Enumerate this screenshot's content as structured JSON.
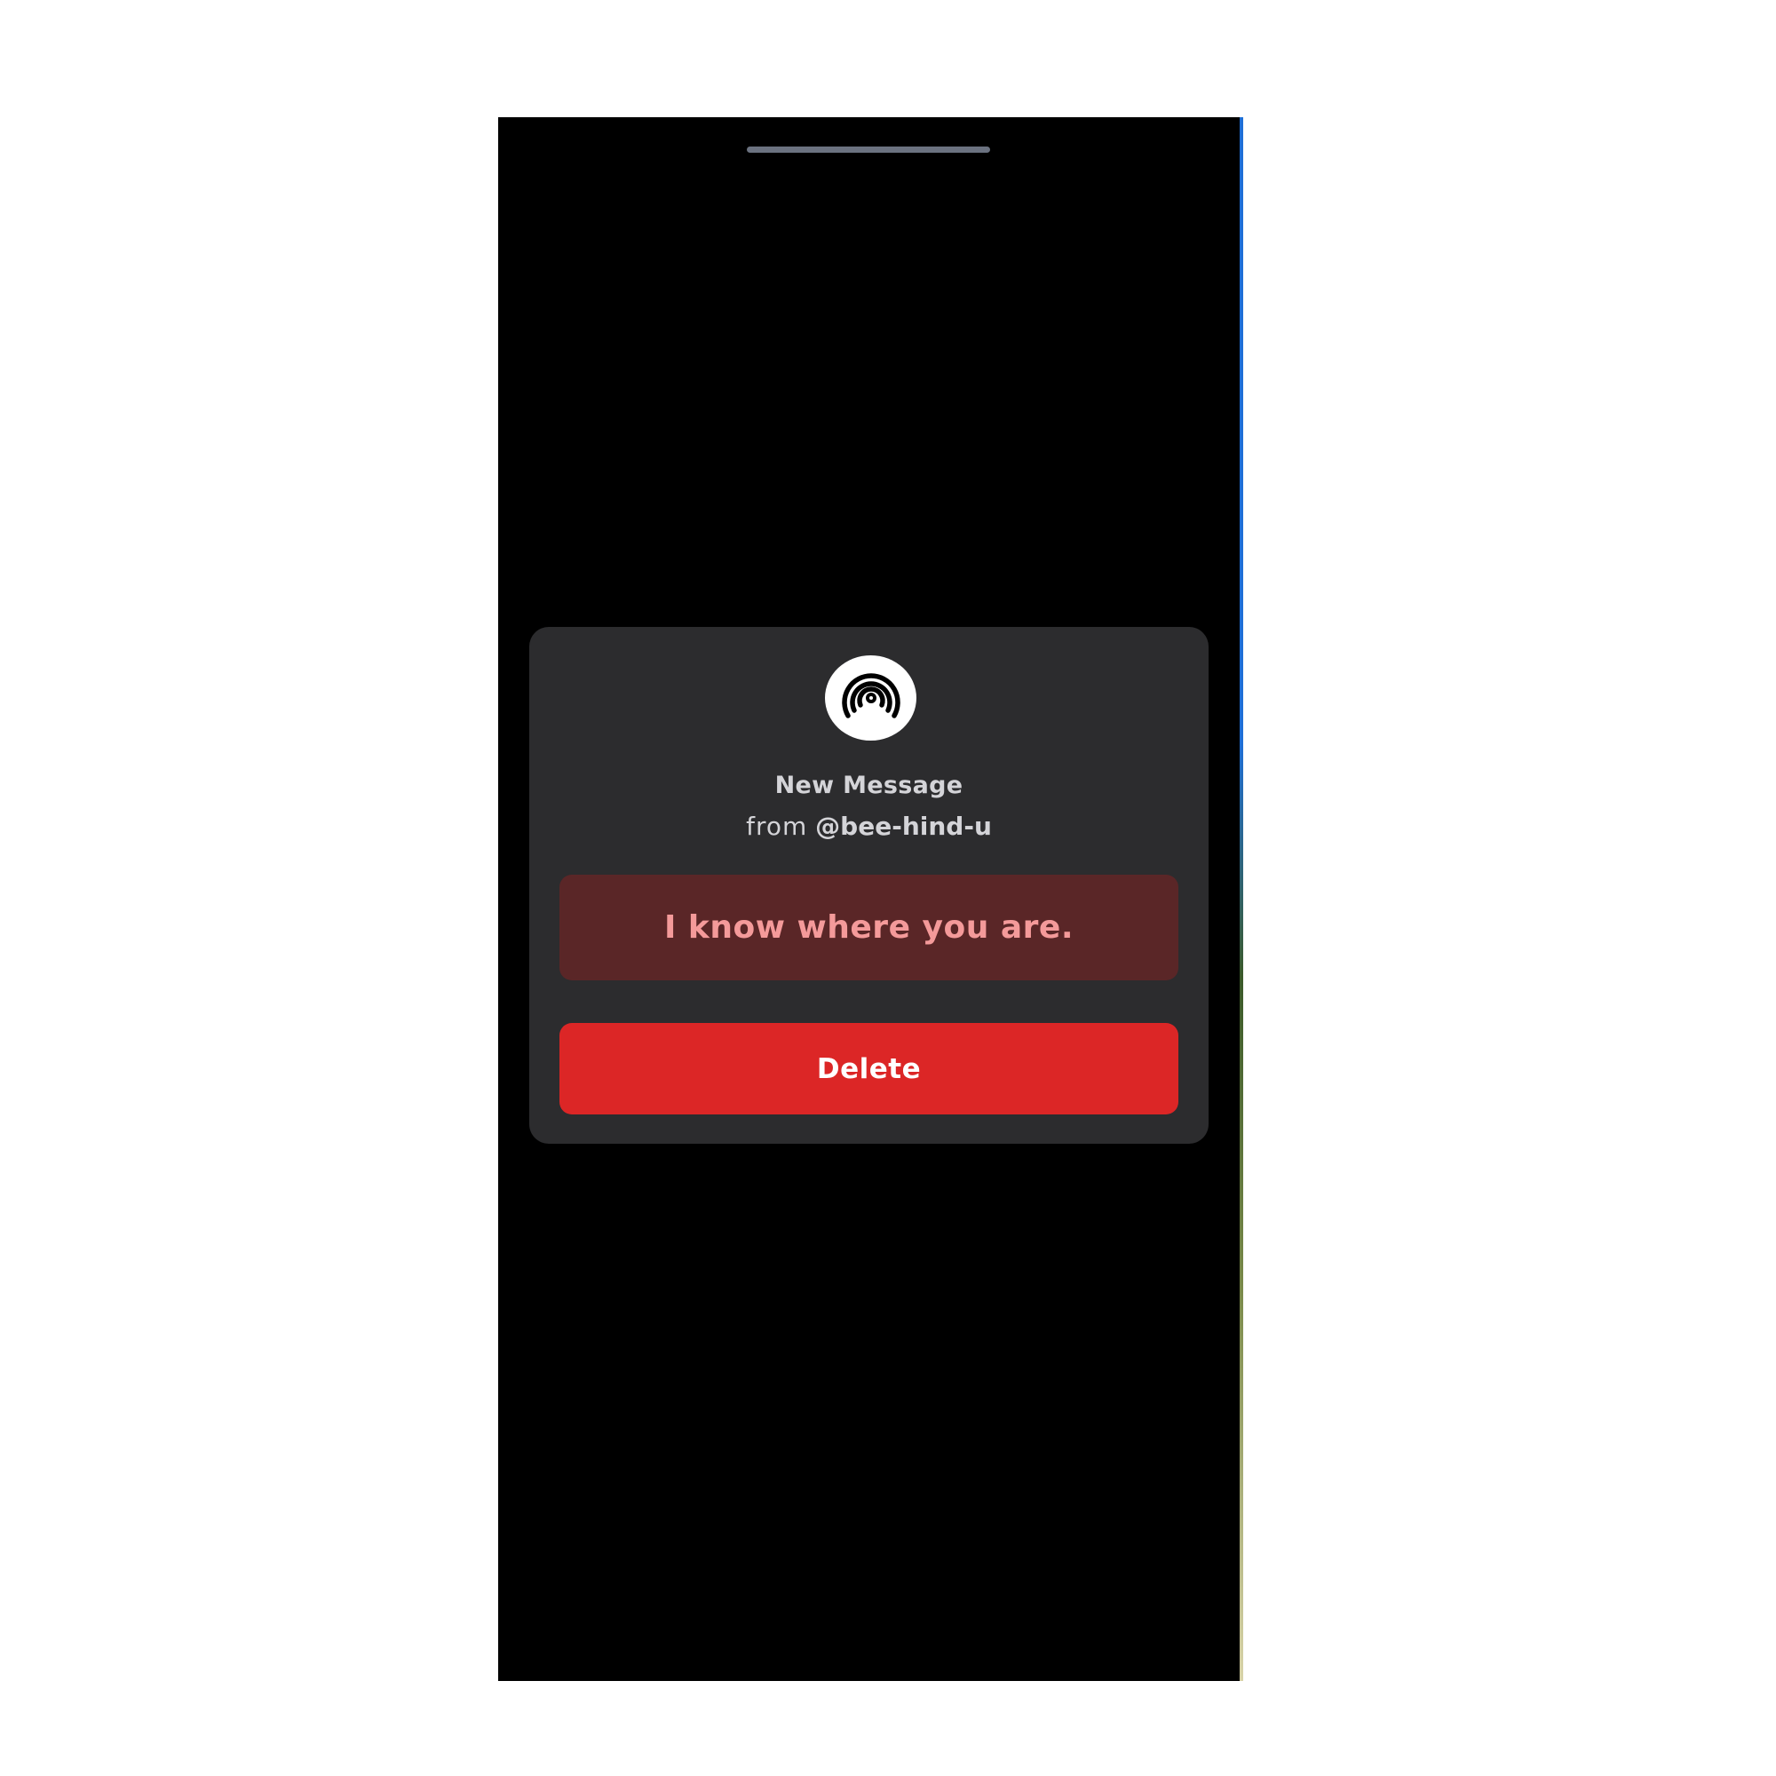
{
  "dialog": {
    "icon": "broadcast-signal-icon",
    "title": "New Message",
    "from_prefix": "from",
    "sender_handle": "@bee-hind-u",
    "message": "I know where you are.",
    "delete_label": "Delete"
  },
  "colors": {
    "screen_background": "#000000",
    "dialog_background": "#2c2c2e",
    "message_background": "#5a2627",
    "message_text": "#f49a9a",
    "delete_button": "#dc2626",
    "home_indicator": "#6b7280"
  }
}
